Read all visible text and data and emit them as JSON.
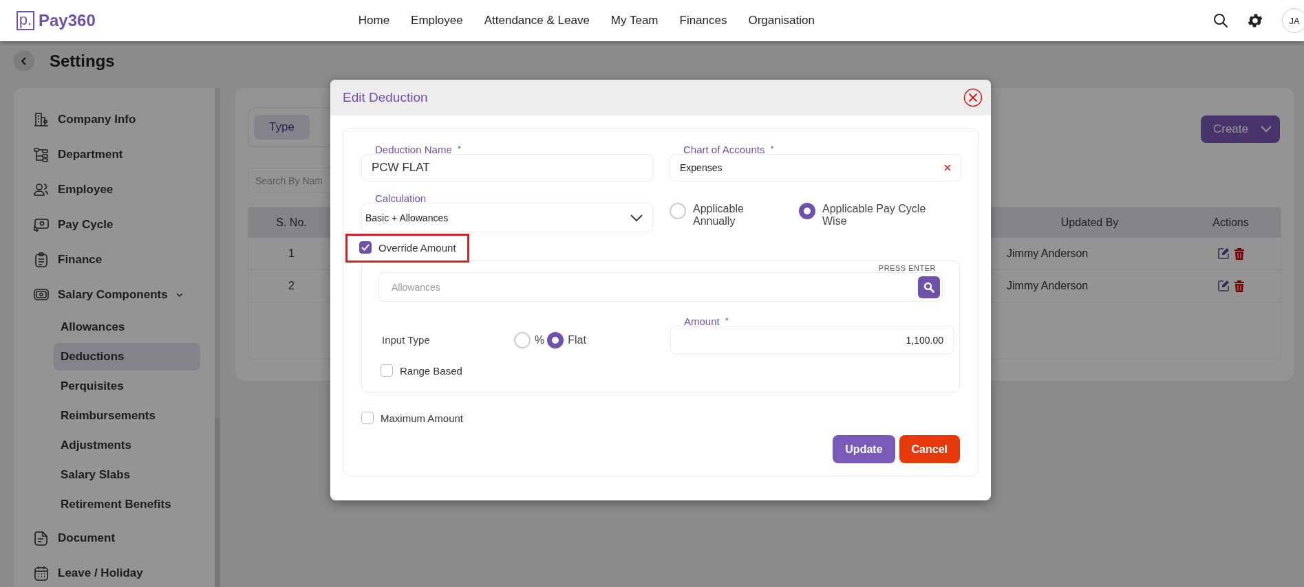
{
  "header": {
    "logo_mark": "p.",
    "logo": "Pay360",
    "nav": [
      {
        "label": "Home"
      },
      {
        "label": "Employee"
      },
      {
        "label": "Attendance & Leave"
      },
      {
        "label": "My Team"
      },
      {
        "label": "Finances"
      },
      {
        "label": "Organisation"
      }
    ],
    "avatar": "JA"
  },
  "page": {
    "title": "Settings"
  },
  "sidebar": {
    "items": [
      {
        "label": "Company Info",
        "selected": false,
        "expanded": false
      },
      {
        "label": "Department",
        "selected": false,
        "expanded": false
      },
      {
        "label": "Employee",
        "selected": false,
        "expanded": false
      },
      {
        "label": "Pay Cycle",
        "selected": false,
        "expanded": false
      },
      {
        "label": "Finance",
        "selected": false,
        "expanded": false
      },
      {
        "label": "Salary Components",
        "selected": false,
        "expanded": true,
        "children": [
          {
            "label": "Allowances",
            "selected": false
          },
          {
            "label": "Deductions",
            "selected": true
          },
          {
            "label": "Perquisites",
            "selected": false
          },
          {
            "label": "Reimbursements",
            "selected": false
          },
          {
            "label": "Adjustments",
            "selected": false
          },
          {
            "label": "Salary Slabs",
            "selected": false
          },
          {
            "label": "Retirement Benefits",
            "selected": false
          }
        ]
      },
      {
        "label": "Document",
        "selected": false,
        "expanded": false
      },
      {
        "label": "Leave / Holiday",
        "selected": false,
        "expanded": false
      }
    ]
  },
  "toolbar": {
    "type_tab": "Type",
    "search_placeholder": "Search By Nam",
    "create_button": "Create"
  },
  "table": {
    "columns": [
      "S. No.",
      "Updated By",
      "Actions"
    ],
    "rows": [
      {
        "s_no": "1",
        "updated_by": "Jimmy Anderson"
      },
      {
        "s_no": "2",
        "updated_by": "Jimmy Anderson"
      }
    ]
  },
  "modal": {
    "title": "Edit Deduction",
    "fields": [
      {
        "label": "Deduction Name",
        "required_mark": "*",
        "value": "PCW FLAT",
        "clearable": false
      },
      {
        "label": "Chart of Accounts",
        "required_mark": "*",
        "value": "Expenses",
        "clearable": true
      }
    ],
    "calculation": {
      "label": "Calculation",
      "value": "Basic + Allowances"
    },
    "applicability": [
      {
        "label": "Applicable Annually",
        "selected": false
      },
      {
        "label": "Applicable Pay Cycle Wise",
        "selected": true
      }
    ],
    "override": {
      "label": "Override Amount",
      "checked": true,
      "highlighted": true
    },
    "allowance_search": {
      "placeholder": "Allowances",
      "hint": "PRESS ENTER"
    },
    "input_type": {
      "label": "Input Type",
      "options": [
        {
          "label": "%",
          "selected": false
        },
        {
          "label": "Flat",
          "selected": true
        }
      ]
    },
    "amount": {
      "label": "Amount",
      "required_mark": "*",
      "value": "1,100.00"
    },
    "range_based": {
      "label": "Range Based",
      "checked": false
    },
    "maximum_amount": {
      "label": "Maximum Amount",
      "checked": false
    },
    "buttons": [
      {
        "label": "Update",
        "kind": "primary"
      },
      {
        "label": "Cancel",
        "kind": "danger"
      }
    ]
  }
}
